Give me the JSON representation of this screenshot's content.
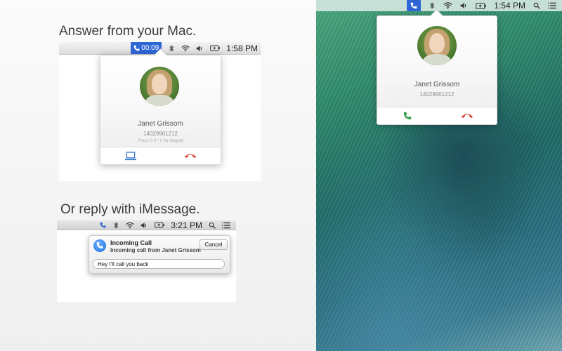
{
  "left_panel": {
    "heading_answer": "Answer from your Mac.",
    "heading_reply": "Or reply with iMessage."
  },
  "example_answer": {
    "menubar": {
      "call_timer": "00:09",
      "clock": "1:58 PM",
      "icons": [
        "phone-icon",
        "bluetooth-icon",
        "wifi-icon",
        "volume-icon",
        "battery-icon"
      ]
    },
    "popup": {
      "contact_name": "Janet Grissom",
      "phone_number": "14029961212",
      "keypad_hint": "Press 0-9 * # for keypad",
      "actions": [
        "laptop-icon",
        "hangup-icon"
      ]
    }
  },
  "example_reply": {
    "menubar": {
      "clock": "3:21 PM",
      "icons": [
        "phone-icon",
        "bluetooth-icon",
        "wifi-icon",
        "volume-icon",
        "battery-icon",
        "search-icon",
        "list-icon"
      ]
    },
    "notification": {
      "title": "Incoming Call",
      "subtitle": "Incoming call from Janet Grissom",
      "cancel_label": "Cancel",
      "reply_text": "Hey I'll call you back"
    }
  },
  "desktop": {
    "menubar": {
      "clock": "1:54 PM",
      "icons": [
        "phone-icon",
        "bluetooth-icon",
        "wifi-icon",
        "volume-icon",
        "battery-icon",
        "search-icon",
        "list-icon"
      ]
    },
    "popup": {
      "contact_name": "Janet Grissom",
      "phone_number": "14029961212",
      "actions": [
        "answer-icon",
        "decline-icon"
      ]
    }
  },
  "colors": {
    "accent_blue": "#2f66d6",
    "answer_green": "#3aa14a",
    "decline_red": "#d9412f",
    "laptop_blue": "#2f72c9"
  }
}
